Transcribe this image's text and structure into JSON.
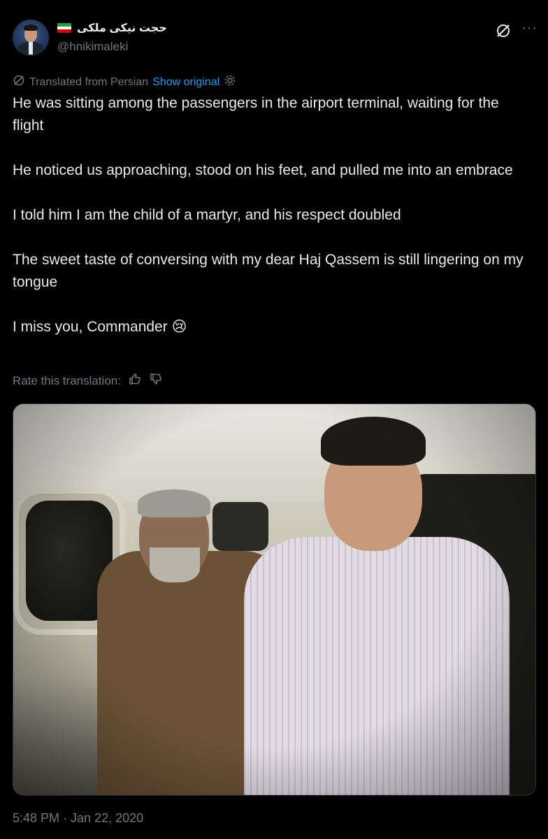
{
  "author": {
    "display_name": "حجت نیکی ملکی",
    "handle": "@hnikimaleki",
    "flag_colors": [
      "#239f40",
      "#ffffff",
      "#da0000"
    ]
  },
  "actions": {
    "grok_icon": "grok-icon",
    "more_label": "···"
  },
  "translation": {
    "translated_label": "Translated from Persian",
    "show_original_label": "Show original",
    "settings_icon": "gear-icon"
  },
  "tweet": {
    "paragraphs": [
      "He was sitting among the passengers in the airport terminal, waiting for the flight",
      "He noticed us approaching, stood on his feet, and pulled me into an embrace",
      "I told him I am the child of a martyr, and his respect doubled",
      "The sweet taste of conversing with my dear Haj Qassem is still lingering on my tongue",
      "I miss you, Commander 😢"
    ]
  },
  "rating": {
    "label": "Rate this translation:",
    "up_icon": "thumbs-up-icon",
    "down_icon": "thumbs-down-icon"
  },
  "media": {
    "alt": "photo"
  },
  "timestamp": "5:48 PM · Jan 22, 2020",
  "colors": {
    "background": "#000000",
    "text": "#e7e9ea",
    "muted": "#71767b",
    "link": "#1d9bf0"
  }
}
